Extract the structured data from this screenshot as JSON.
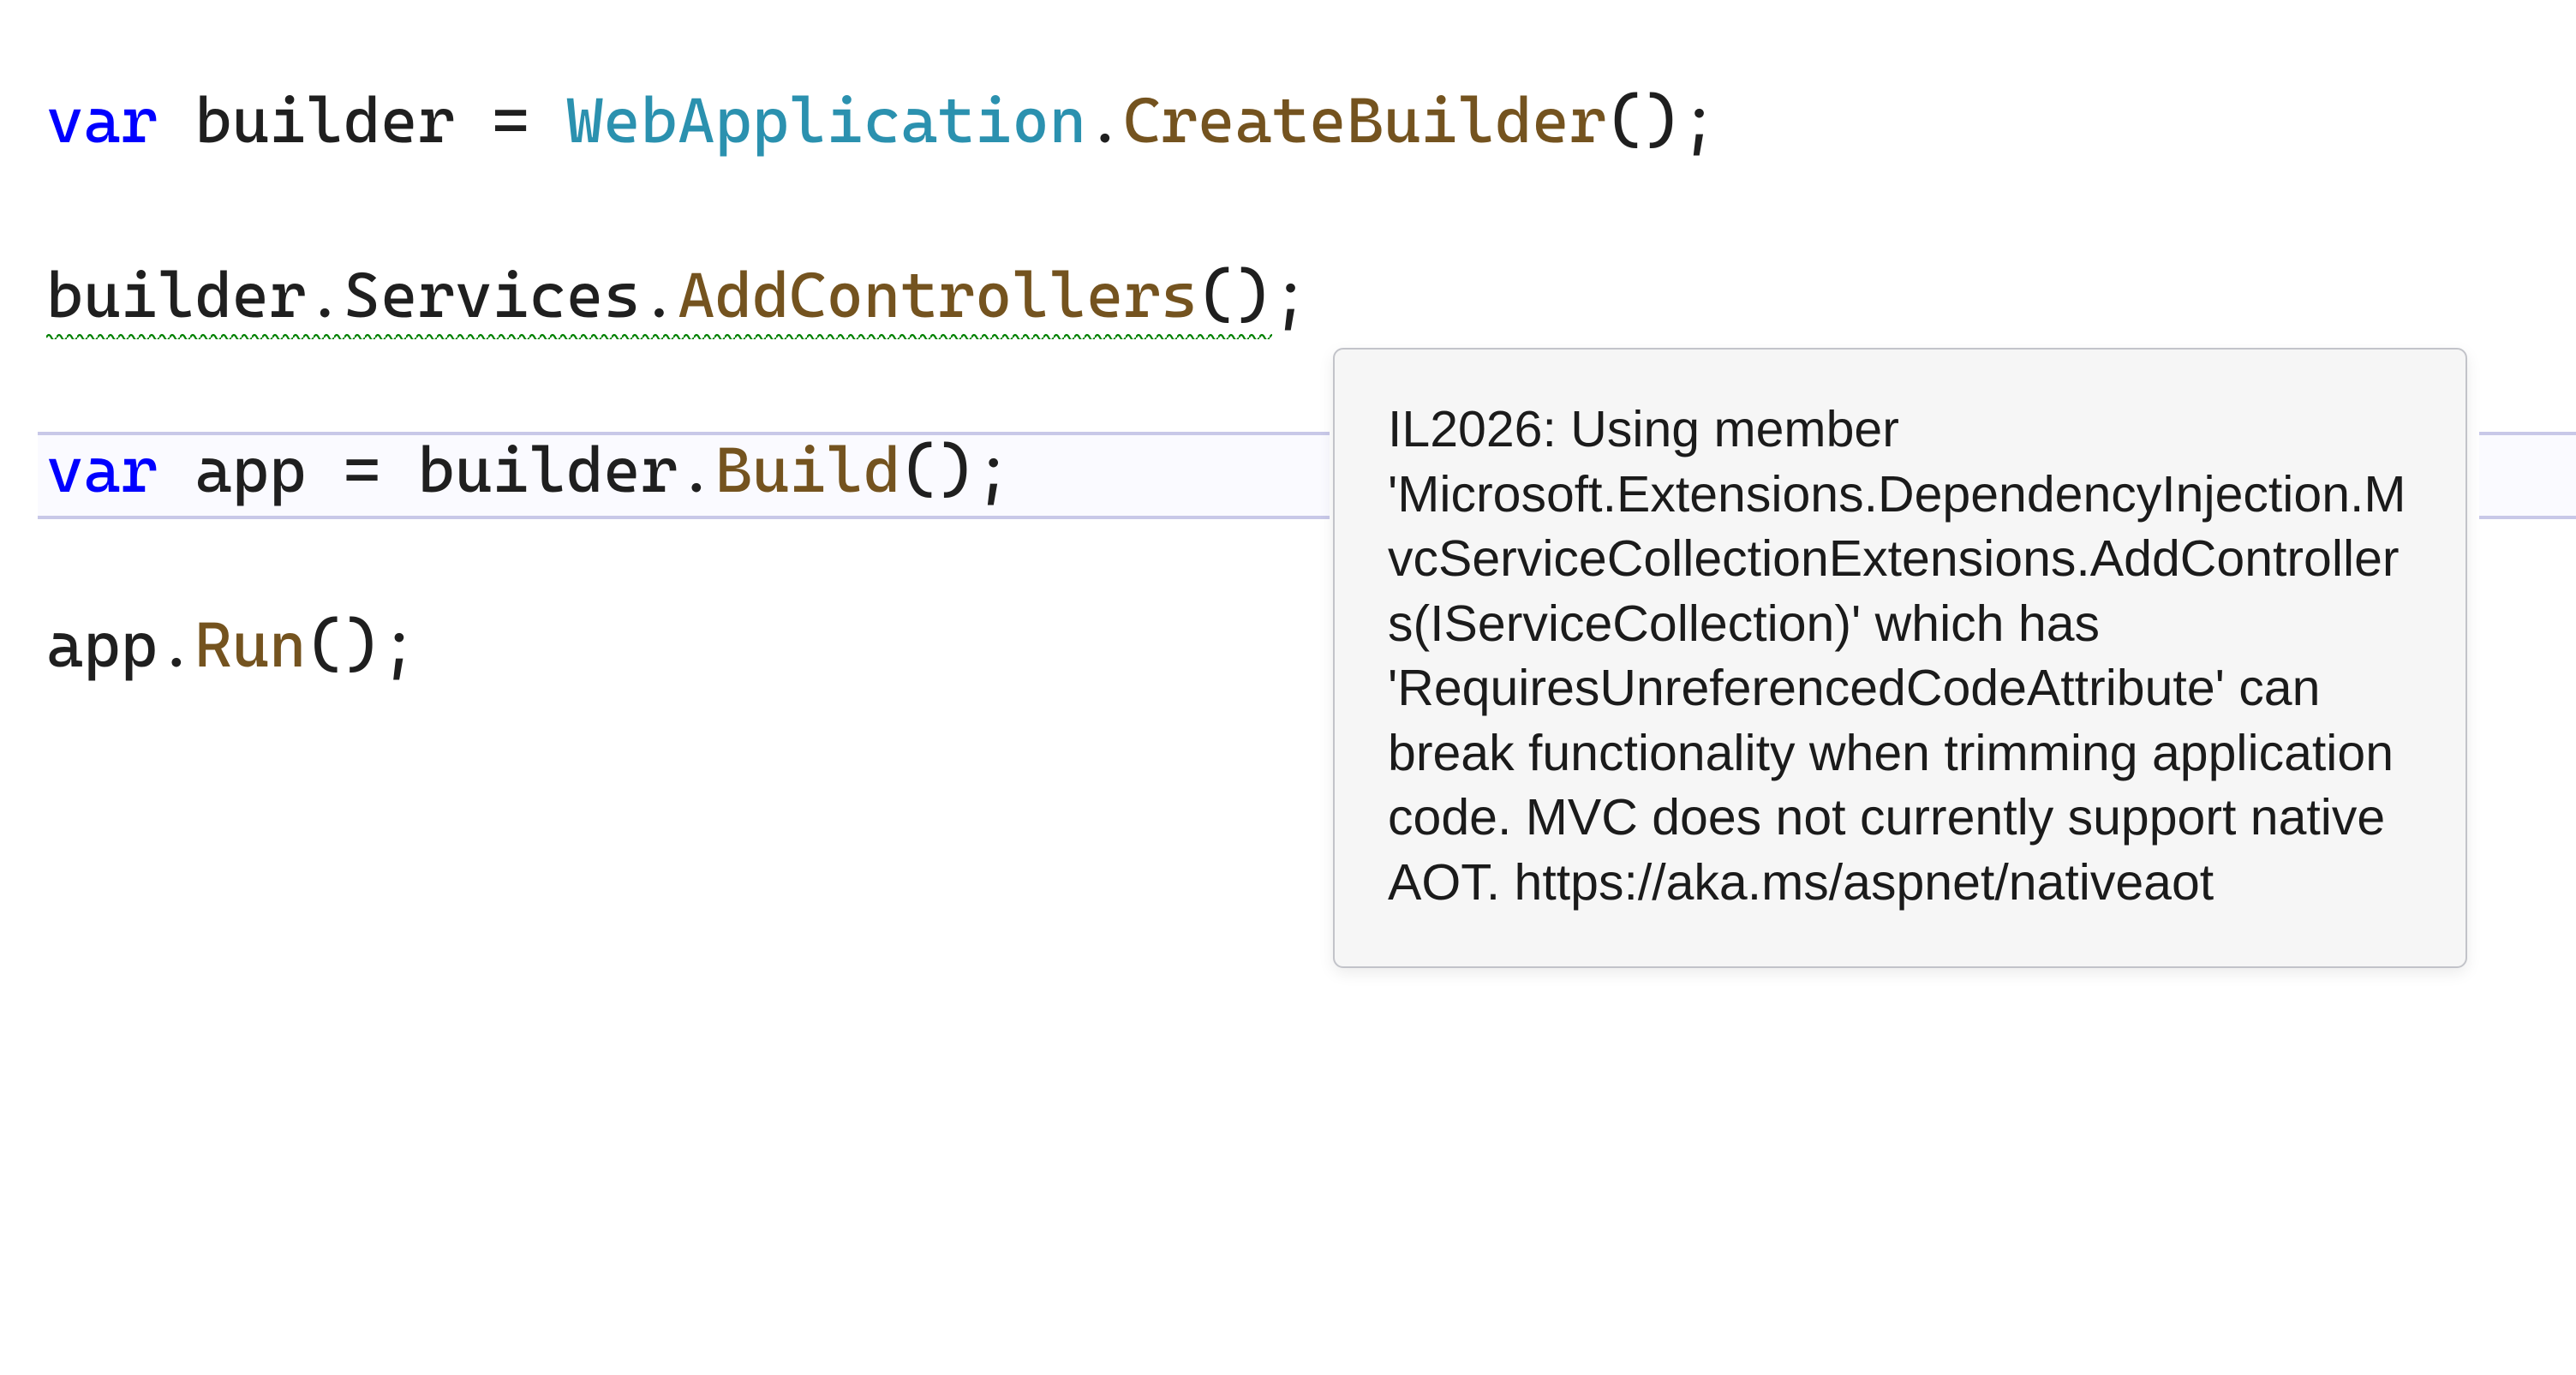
{
  "code": {
    "line1": {
      "kw_var": "var",
      "sp1": " ",
      "ident_builder": "builder",
      "sp2": " ",
      "op_eq": "=",
      "sp3": " ",
      "type_webapp": "WebApplication",
      "dot1": ".",
      "mthd_createbuilder": "CreateBuilder",
      "parens_semi": "();"
    },
    "line3": {
      "squiggle_text_builder": "builder",
      "dot1": ".",
      "squiggle_text_services": "Services",
      "dot2": ".",
      "squiggle_text_addcontrollers": "AddControllers",
      "squiggle_text_parens": "()",
      "semi": ";"
    },
    "line5": {
      "kw_var": "var",
      "sp1": " ",
      "ident_app": "app",
      "sp2": " ",
      "op_eq": "=",
      "sp3": " ",
      "ident_builder": "builder",
      "dot1": ".",
      "mthd_build": "Build",
      "parens_semi": "();"
    },
    "line7": {
      "ident_app": "app",
      "dot1": ".",
      "mthd_run": "Run",
      "parens_semi": "();"
    }
  },
  "tooltip": {
    "message": "IL2026: Using member 'Microsoft.Extensions.DependencyInjection.MvcServiceCollectionExtensions.AddControllers(IServiceCollection)' which has 'RequiresUnreferencedCodeAttribute' can break functionality when trimming application code. MVC does not currently support native AOT. https://aka.ms/aspnet/nativeaot"
  }
}
